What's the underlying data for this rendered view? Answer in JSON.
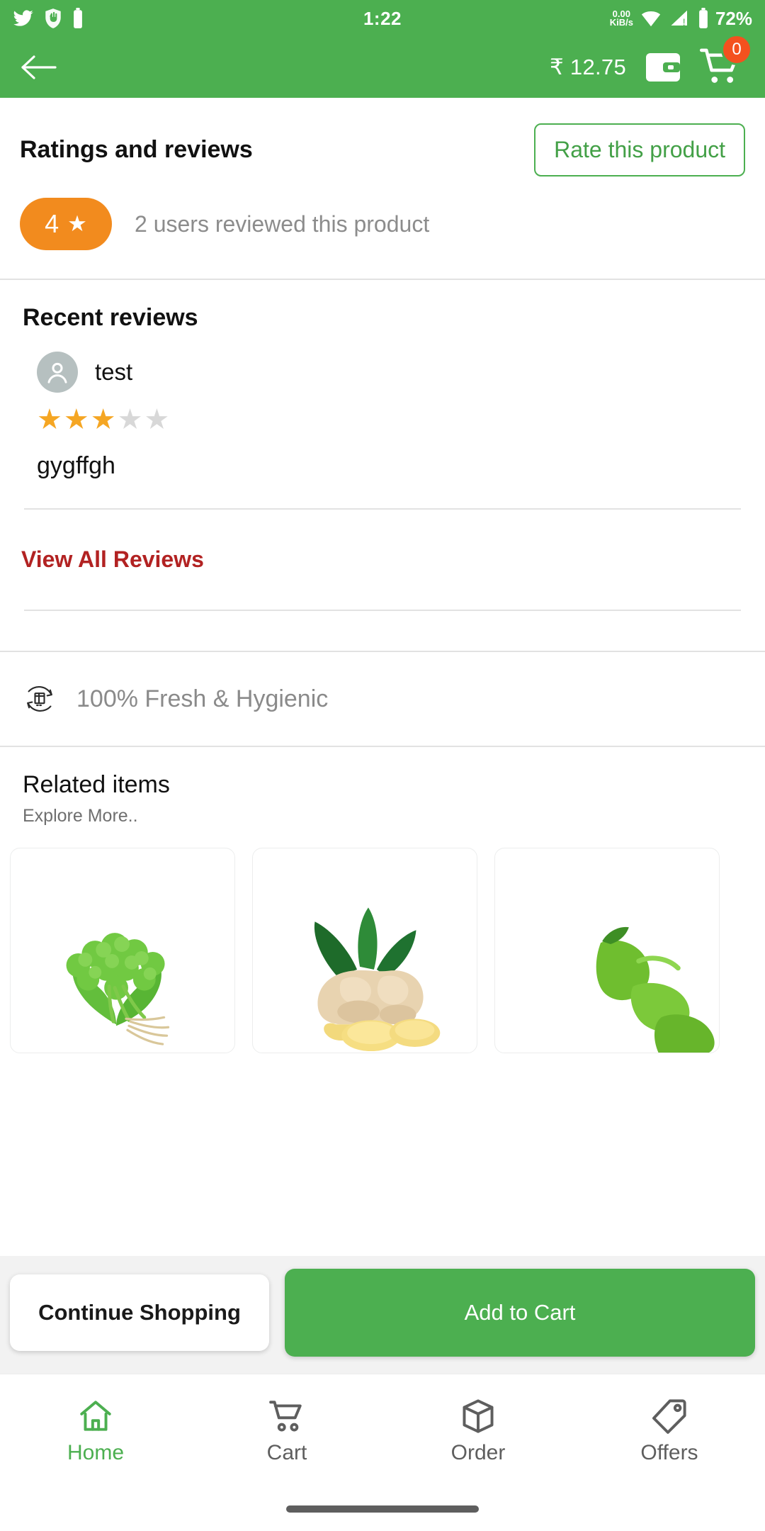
{
  "status_bar": {
    "time": "1:22",
    "network_speed": "0.00",
    "network_unit": "KiB/s",
    "battery": "72%",
    "icons": [
      "twitter-icon",
      "shield-hand-icon",
      "battery-saver-icon",
      "wifi-icon",
      "signal-icon",
      "battery-icon"
    ]
  },
  "toolbar": {
    "back_icon": "arrow-left-icon",
    "wallet_balance": "₹ 12.75",
    "wallet_icon": "wallet-icon",
    "cart_icon": "shopping-cart-icon",
    "cart_badge": "0"
  },
  "ratings": {
    "title": "Ratings and reviews",
    "rate_button": "Rate this product",
    "score": "4",
    "star_glyph": "★",
    "count_text": "2 users reviewed this product",
    "pill_color": "#F28B1E"
  },
  "recent_reviews": {
    "title": "Recent reviews",
    "items": [
      {
        "avatar_icon": "person-avatar-icon",
        "name": "test",
        "stars_filled": 3,
        "stars_total": 5,
        "comment": "gygffgh"
      }
    ],
    "view_all": "View All Reviews",
    "view_all_color": "#B22222"
  },
  "fresh_banner": {
    "icon": "fresh-box-rotate-icon",
    "text": "100% Fresh & Hygienic"
  },
  "related": {
    "title": "Related items",
    "subtitle": "Explore More..",
    "items": [
      {
        "image_name": "coriander-bunch-image"
      },
      {
        "image_name": "ginger-root-image"
      },
      {
        "image_name": "green-chilli-image"
      }
    ]
  },
  "action_bar": {
    "continue_label": "Continue Shopping",
    "add_to_cart_label": "Add to Cart",
    "accent_color": "#4CAF50"
  },
  "bottom_nav": {
    "items": [
      {
        "label": "Home",
        "icon": "home-icon",
        "active": true
      },
      {
        "label": "Cart",
        "icon": "cart-icon",
        "active": false
      },
      {
        "label": "Order",
        "icon": "box-icon",
        "active": false
      },
      {
        "label": "Offers",
        "icon": "tag-icon",
        "active": false
      }
    ]
  },
  "theme": {
    "brand_green": "#4CAF50",
    "badge_orange": "#F4511E",
    "rating_orange": "#F28B1E"
  }
}
